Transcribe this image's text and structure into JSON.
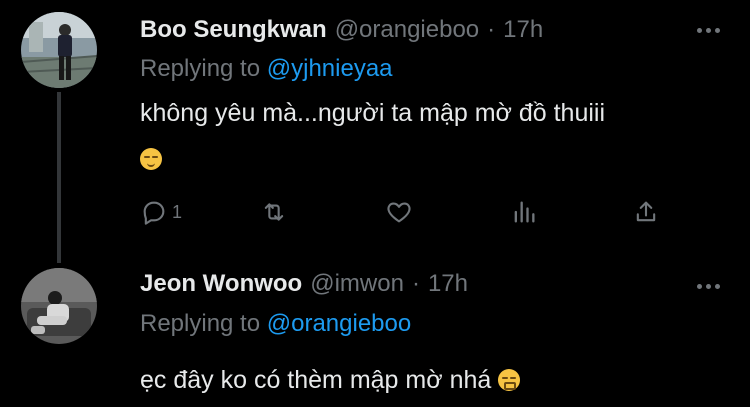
{
  "tweets": [
    {
      "name": "Boo Seungkwan",
      "handle": "@orangieboo",
      "dot": "·",
      "time": "17h",
      "replying_prefix": "Replying to",
      "replying_to": "@yjhnieyaa",
      "text": "không yêu mà...người ta mập mờ đồ thuiii",
      "emoji": "relieved-face-icon",
      "reply_count": "1"
    },
    {
      "name": "Jeon Wonwoo",
      "handle": "@imwon",
      "dot": "·",
      "time": "17h",
      "replying_prefix": "Replying to",
      "replying_to": "@orangieboo",
      "text": "ẹc đây ko có thèm mập mờ nhá",
      "emoji": "confounded-face-icon"
    }
  ],
  "colors": {
    "background": "#000000",
    "text": "#e7e9ea",
    "muted": "#71767b",
    "link": "#1d9bf0",
    "thread_line": "#333639"
  }
}
